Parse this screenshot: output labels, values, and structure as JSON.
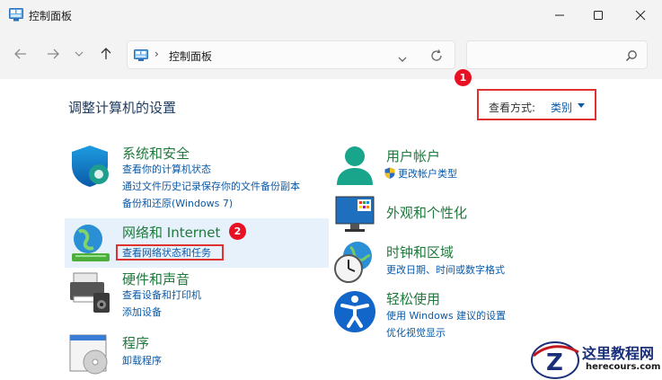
{
  "window": {
    "title": "控制面板",
    "address_path": "控制面板",
    "address_separator": "›",
    "search_placeholder": ""
  },
  "icons": {
    "app": "control-panel-icon",
    "minimize": "minimize-icon",
    "maximize": "maximize-icon",
    "close": "close-icon",
    "back": "arrow-left-icon",
    "forward": "arrow-right-icon",
    "recent": "chevron-down-icon",
    "up": "arrow-up-icon",
    "refresh": "refresh-icon",
    "search": "search-icon"
  },
  "content": {
    "title": "调整计算机的设置",
    "view_by_label": "查看方式:",
    "view_by_value": "类别"
  },
  "annotations": {
    "badge_1": "1",
    "badge_2": "2",
    "highlight_color": "#e03131"
  },
  "categories": {
    "security": {
      "heading": "系统和安全",
      "links": [
        "查看你的计算机状态",
        "通过文件历史记录保存你的文件备份副本",
        "备份和还原(Windows 7)"
      ]
    },
    "network": {
      "heading": "网络和 Internet",
      "links": [
        "查看网络状态和任务"
      ]
    },
    "hardware": {
      "heading": "硬件和声音",
      "links": [
        "查看设备和打印机",
        "添加设备"
      ]
    },
    "programs": {
      "heading": "程序",
      "links": [
        "卸载程序"
      ]
    },
    "accounts": {
      "heading": "用户帐户",
      "links": [
        "更改帐户类型"
      ]
    },
    "appearance": {
      "heading": "外观和个性化",
      "links": []
    },
    "clock": {
      "heading": "时钟和区域",
      "links": [
        "更改日期、时间或数字格式"
      ]
    },
    "ease": {
      "heading": "轻松使用",
      "links": [
        "使用 Windows 建议的设置",
        "优化视觉显示"
      ]
    }
  },
  "watermark": {
    "title": "这里教程网",
    "url": "herecours.com"
  },
  "colors": {
    "heading_green": "#1f7a3c",
    "link_blue": "#0a5aa8",
    "badge_red": "#e81123"
  }
}
